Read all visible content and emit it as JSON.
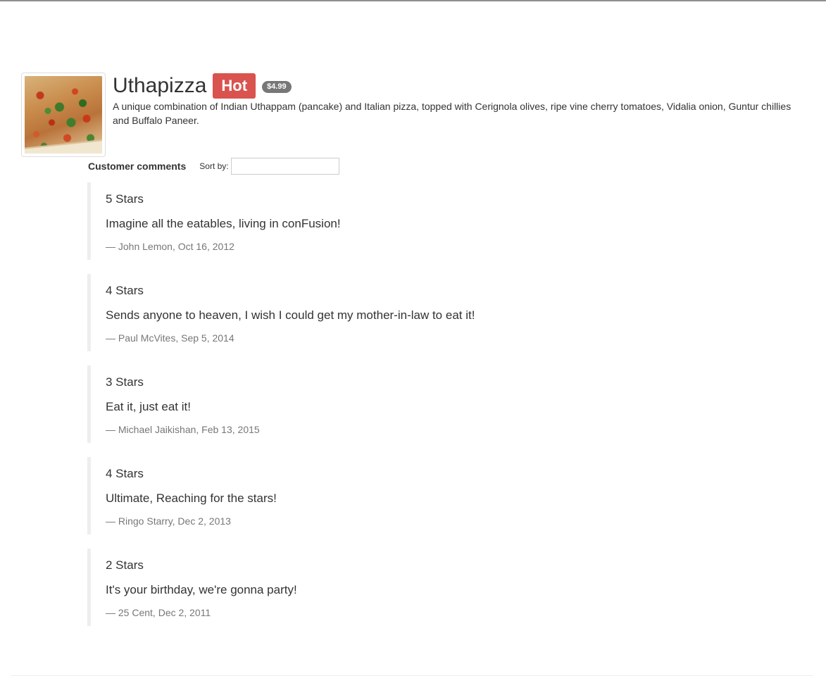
{
  "dish": {
    "name": "Uthapizza",
    "label": "Hot",
    "price": "$4.99",
    "description": "A unique combination of Indian Uthappam (pancake) and Italian pizza, topped with Cerignola olives, ripe vine cherry tomatoes, Vidalia onion, Guntur chillies and Buffalo Paneer.",
    "image_icon": "pizza-image"
  },
  "comments_section": {
    "title": "Customer comments",
    "sort_label": "Sort by:",
    "sort_value": ""
  },
  "comments": [
    {
      "rating": "5 Stars",
      "text": "Imagine all the eatables, living in conFusion!",
      "footer": "— John Lemon, Oct 16, 2012"
    },
    {
      "rating": "4 Stars",
      "text": "Sends anyone to heaven, I wish I could get my mother-in-law to eat it!",
      "footer": "— Paul McVites, Sep 5, 2014"
    },
    {
      "rating": "3 Stars",
      "text": "Eat it, just eat it!",
      "footer": "— Michael Jaikishan, Feb 13, 2015"
    },
    {
      "rating": "4 Stars",
      "text": "Ultimate, Reaching for the stars!",
      "footer": "— Ringo Starry, Dec 2, 2013"
    },
    {
      "rating": "2 Stars",
      "text": "It's your birthday, we're gonna party!",
      "footer": "— 25 Cent, Dec 2, 2011"
    }
  ],
  "colors": {
    "label_hot": "#d9534f",
    "badge_price": "#777777",
    "blockquote_border": "#eeeeee",
    "muted_text": "#777777"
  }
}
